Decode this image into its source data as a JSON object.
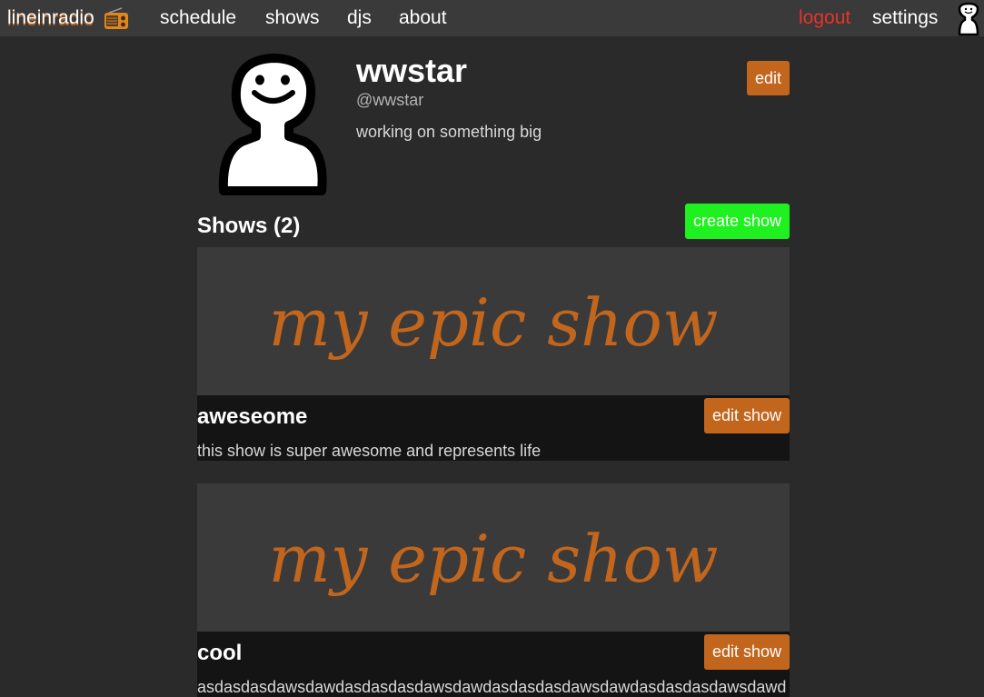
{
  "nav": {
    "brand": "lineinradio",
    "brand_icon": "radio-icon",
    "links": [
      "schedule",
      "shows",
      "djs",
      "about"
    ],
    "logout": "logout",
    "settings": "settings",
    "avatar_icon": "stick-figure-avatar"
  },
  "profile": {
    "name": "wwstar",
    "handle": "@wwstar",
    "bio": "working on something big",
    "edit_label": "edit"
  },
  "shows_section": {
    "heading": "Shows (2)",
    "create_label": "create show"
  },
  "shows": [
    {
      "banner_text": "my epic show",
      "title": "aweseome",
      "description": "this show is super awesome and represents life",
      "edit_label": "edit show"
    },
    {
      "banner_text": "my epic show",
      "title": "cool",
      "description": "asdasdasdawsdawdasdasdasdawsdawdasdasdasdawsdawdasdasdasdawsdawd",
      "edit_label": "edit show"
    }
  ],
  "colors": {
    "background": "#2a2a2a",
    "navbar": "#3a3a3a",
    "accent_orange": "#c2661d",
    "create_green": "#1ff01f",
    "logout_red": "#e8332a",
    "card_info": "#141414"
  }
}
